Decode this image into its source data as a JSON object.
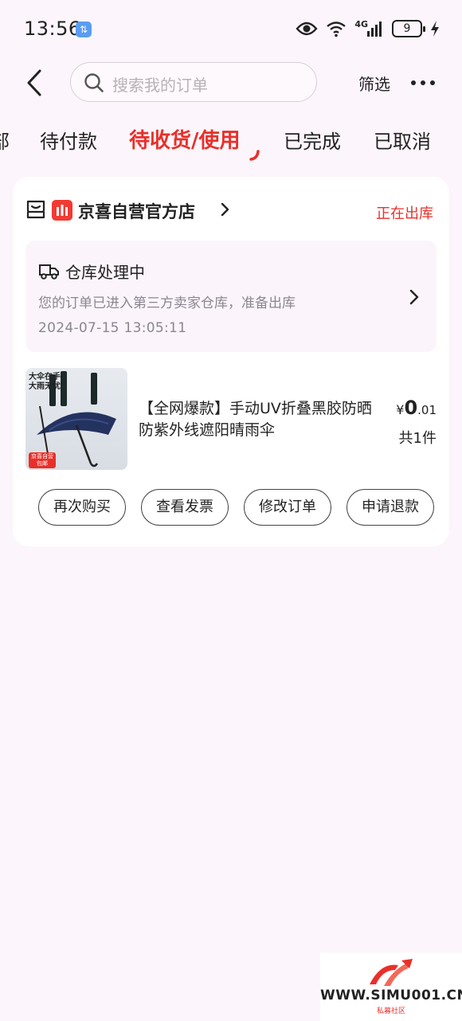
{
  "status_bar": {
    "time": "13:56",
    "data_badge": "⇅",
    "network": "4G",
    "battery": "9"
  },
  "nav": {
    "search_placeholder": "搜索我的订单",
    "filter_label": "筛选"
  },
  "tabs": [
    {
      "label": "部"
    },
    {
      "label": "待付款"
    },
    {
      "label": "待收货/使用",
      "active": true
    },
    {
      "label": "已完成"
    },
    {
      "label": "已取消"
    }
  ],
  "order": {
    "shop_name": "京喜自营官方店",
    "status": "正在出库",
    "logistics": {
      "title": "仓库处理中",
      "desc": "您的订单已进入第三方卖家仓库，准备出库",
      "time": "2024-07-15 13:05:11"
    },
    "product": {
      "thumb_text_1": "大伞在手",
      "thumb_text_2": "大雨无忧",
      "thumb_badge_1": "京喜自营",
      "thumb_badge_2": "包邮",
      "title": "【全网爆款】手动UV折叠黑胶防晒防紫外线遮阳晴雨伞",
      "price_currency": "¥",
      "price_int": "0",
      "price_dec": ".01",
      "quantity": "共1件"
    },
    "actions": [
      {
        "label": "再次购买"
      },
      {
        "label": "查看发票"
      },
      {
        "label": "修改订单"
      },
      {
        "label": "申请退款"
      }
    ]
  },
  "watermark": {
    "text": "WWW.SIMU001.CN",
    "sub": "私募社区"
  },
  "colors": {
    "accent": "#e8302a",
    "background": "#fcf5fb"
  }
}
